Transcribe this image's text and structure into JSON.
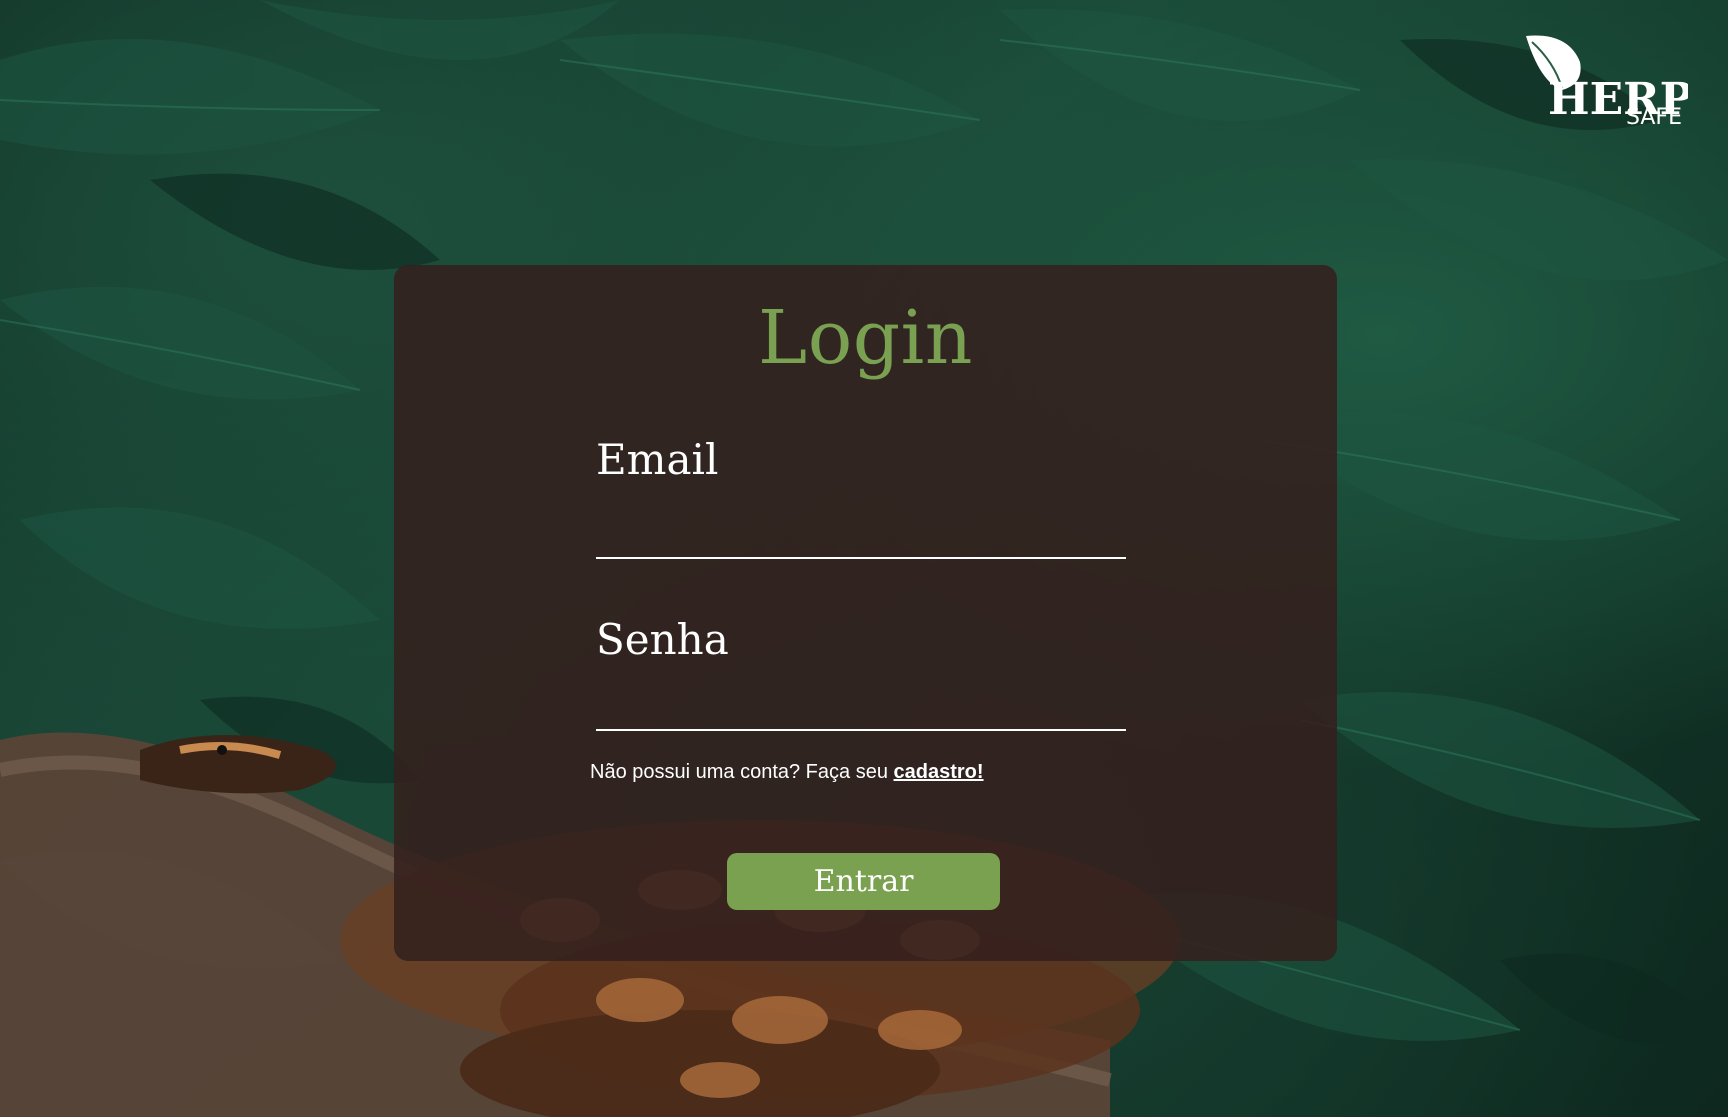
{
  "brand": {
    "logo_text_1": "HERP",
    "logo_text_2": "SAFE"
  },
  "login": {
    "title": "Login",
    "email_label": "Email",
    "email_value": "",
    "senha_label": "Senha",
    "senha_value": "",
    "signup_prompt": "Não possui uma conta? Faça seu",
    "signup_link": "cadastro!",
    "submit_label": "Entrar"
  },
  "colors": {
    "accent": "#79a151",
    "card": "#34201e",
    "background": "#123326"
  },
  "icons": {
    "logo": "leaf-logo-icon",
    "background": "leaves-background",
    "snake": "snake-illustration"
  }
}
